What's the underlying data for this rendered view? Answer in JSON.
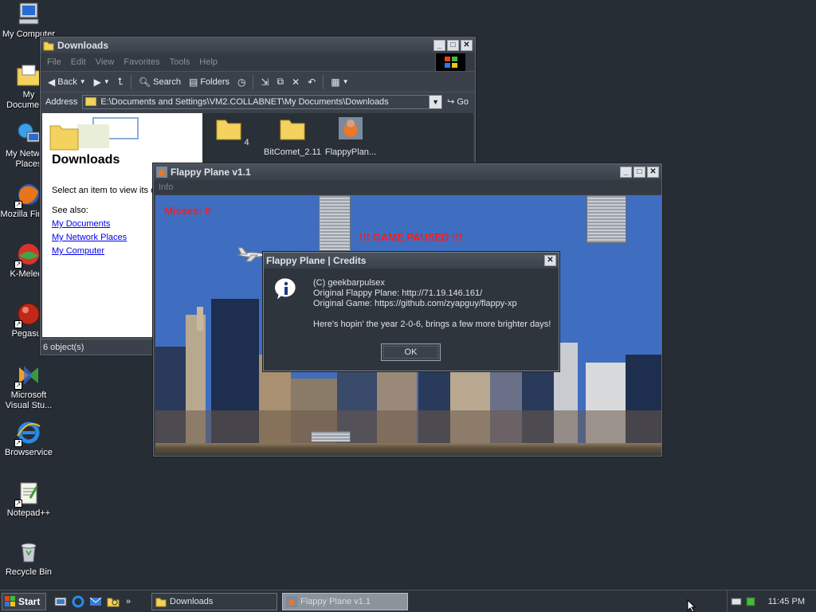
{
  "desktop": {
    "icons": [
      {
        "label": "My Computer"
      },
      {
        "label": "My Documents"
      },
      {
        "label": "My Network Places"
      },
      {
        "label": "Mozilla Firefox"
      },
      {
        "label": "K-Meleon"
      },
      {
        "label": "Pegasus"
      },
      {
        "label": "Microsoft Visual Stu..."
      },
      {
        "label": "Browservice"
      },
      {
        "label": "Notepad++"
      },
      {
        "label": "Recycle Bin"
      }
    ]
  },
  "explorer": {
    "title": "Downloads",
    "menu": [
      "File",
      "Edit",
      "View",
      "Favorites",
      "Tools",
      "Help"
    ],
    "toolbar": {
      "back": "Back",
      "search": "Search",
      "folders": "Folders"
    },
    "address_label": "Address",
    "address": "E:\\Documents and Settings\\VM2.COLLABNET\\My Documents\\Downloads",
    "go": "Go",
    "taskpane": {
      "title": "Downloads",
      "description": "Select an item to view its description.",
      "see_also": "See also:",
      "links": [
        "My Documents",
        "My Network Places",
        "My Computer"
      ]
    },
    "files": [
      {
        "name": "4",
        "icon": "folder-icon"
      },
      {
        "name": "BitComet_2.11",
        "icon": "folder-icon"
      },
      {
        "name": "FlappyPlan...",
        "icon": "app-icon"
      }
    ],
    "status": "6 object(s)"
  },
  "flappy": {
    "title": "Flappy Plane v1.1",
    "menu": "Info",
    "misses": "Misses: 0",
    "paused": "!!! GAME PAUSED !!!"
  },
  "dialog": {
    "title": "Flappy Plane | Credits",
    "lines": [
      "(C) geekbarpulsex",
      "Original Flappy Plane: http://71.19.146.161/",
      "Original Game: https://github.com/zyapguy/flappy-xp",
      "Here's hopin' the year 2-0-6, brings a few more brighter days!"
    ],
    "ok": "OK"
  },
  "taskbar": {
    "start": "Start",
    "tasks": [
      {
        "label": "Downloads"
      },
      {
        "label": "Flappy Plane v1.1"
      }
    ],
    "clock": "11:45 PM"
  }
}
